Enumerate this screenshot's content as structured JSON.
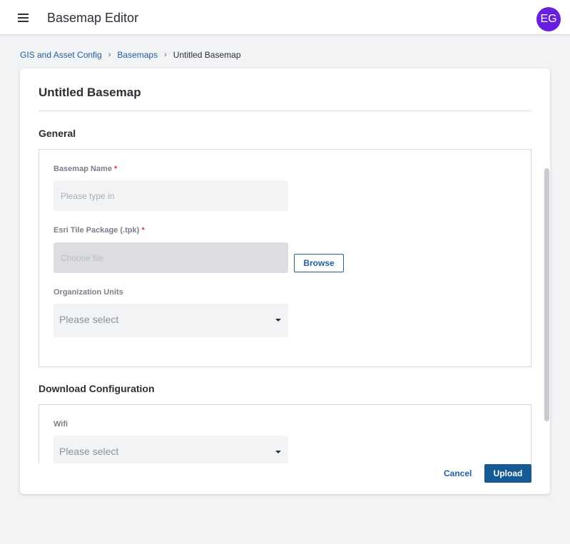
{
  "appbar": {
    "title": "Basemap Editor",
    "avatar_initials": "EG",
    "avatar_color": "#6a1fe0"
  },
  "breadcrumb": {
    "items": [
      "GIS and Asset Config",
      "Basemaps"
    ],
    "current": "Untitled Basemap",
    "separator": "›"
  },
  "card": {
    "title": "Untitled Basemap",
    "general": {
      "title": "General",
      "basemap_name": {
        "label": "Basemap Name",
        "required_mark": "*",
        "value": "",
        "placeholder": "Please type in"
      },
      "tile_package": {
        "label": "Esri Tile Package (.tpk)",
        "required_mark": "*",
        "value": "",
        "placeholder": "Choose file",
        "browse_label": "Browse"
      },
      "org_units": {
        "label": "Organization Units",
        "selected": "Please select"
      }
    },
    "download": {
      "title": "Download Configuration",
      "wifi": {
        "label": "Wifi",
        "selected": "Please select"
      }
    },
    "actions": {
      "cancel_label": "Cancel",
      "upload_label": "Upload"
    }
  },
  "colors": {
    "accent": "#1f5f9c",
    "primary_button": "#155a92",
    "required": "#d93a3a"
  }
}
